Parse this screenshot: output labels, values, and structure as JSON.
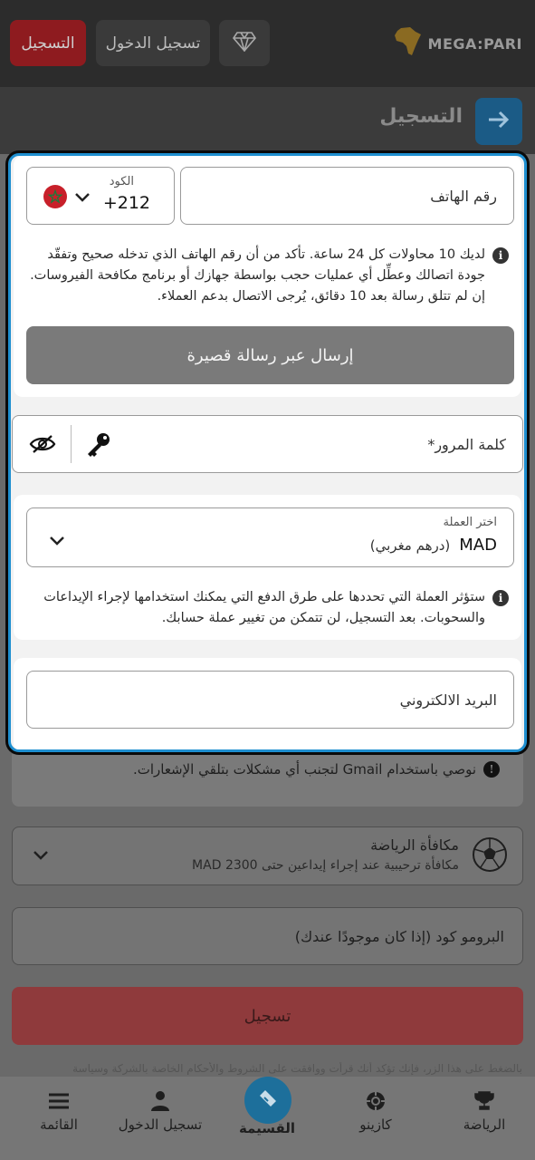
{
  "topbar": {
    "register_label": "التسجيل",
    "login_label": "تسجيل الدخول",
    "logo_text": "MEGA:PARI"
  },
  "header": {
    "title": "التسجيل"
  },
  "phone": {
    "code_label": "الكود",
    "code_value": "+212",
    "country_flag": "morocco-flag",
    "placeholder": "رقم الهاتف",
    "note": "لديك 10 محاولات كل 24 ساعة. تأكد من أن رقم الهاتف الذي تدخله صحيح وتفقّد جودة اتصالك وعطِّل أي عمليات حجب بواسطة جهازك أو برنامج مكافحة الفيروسات. إن لم تتلق رسالة بعد 10 دقائق، يُرجى الاتصال بدعم العملاء.",
    "sms_button": "إرسال عبر رسالة قصيرة"
  },
  "password": {
    "placeholder": "كلمة المرور*"
  },
  "currency": {
    "label": "اختر العملة",
    "code": "MAD",
    "name": "(درهم مغربي)",
    "note": "ستؤثر العملة التي تحددها على طرق الدفع التي يمكنك استخدامها لإجراء الإيداعات والسحوبات. بعد التسجيل، لن تتمكن من تغيير عملة حسابك."
  },
  "email": {
    "placeholder": "البريد الالكتروني",
    "gmail_note": "نوصي باستخدام Gmail لتجنب أي مشكلات بتلقي الإشعارات."
  },
  "bonus": {
    "title": "مكافأة الرياضة",
    "subtitle": "مكافأة ترحيبية عند إجراء إيداعين حتى 2300 MAD"
  },
  "promo": {
    "placeholder": "البرومو كود (إذا كان موجودًا عندك)"
  },
  "register_button": "تسجيل",
  "faded_text": "بالضغط على هذا الزر، فإنك تؤكد أنك قرأت ووافقت على الشروط والأحكام الخاصة بالشركة وسياسة",
  "nav": {
    "sports": "الرياضة",
    "casino": "كازينو",
    "coupon": "القسيمة",
    "login": "تسجيل الدخول",
    "menu": "القائمة"
  },
  "colors": {
    "accent": "#1e8fd0",
    "register_red": "#d9262c",
    "sms_button": "#7a7a7a"
  }
}
